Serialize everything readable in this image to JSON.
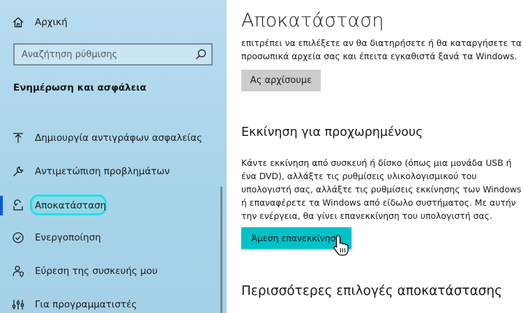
{
  "sidebar": {
    "home_label": "Αρχική",
    "search_placeholder": "Αναζήτηση ρύθμισης",
    "section_heading": "Ενημέρωση και ασφάλεια",
    "items": [
      {
        "label": "Δημιουργία αντιγράφων ασφαλείας",
        "icon": "backup-arrow-icon"
      },
      {
        "label": "Αντιμετώπιση προβλημάτων",
        "icon": "wrench-icon"
      },
      {
        "label": "Αποκατάσταση",
        "icon": "recovery-icon",
        "active": true
      },
      {
        "label": "Ενεργοποίηση",
        "icon": "check-circle-icon"
      },
      {
        "label": "Εύρεση της συσκευής μου",
        "icon": "person-location-icon"
      },
      {
        "label": "Για προγραμματιστές",
        "icon": "developer-tools-icon"
      }
    ]
  },
  "main": {
    "title": "Αποκατάσταση",
    "reset_text": [
      "επιτρέπει να επιλέξετε αν θα διατηρήσετε ή θα καταργήσετε τα",
      "προσωπικά αρχεία σας και έπειτα εγκαθιστά ξανά τα Windows."
    ],
    "reset_button": "Ας αρχίσουμε",
    "advanced_heading": "Εκκίνηση για προχωρημένους",
    "advanced_text": [
      "Κάντε εκκίνηση από συσκευή ή δίσκο (όπως μια μονάδα USB ή",
      "ένα DVD), αλλάξτε τις ρυθμίσεις υλικολογισμικού του",
      "υπολογιστή σας, αλλάξτε τις ρυθμίσεις εκκίνησης των Windows",
      "ή επαναφέρετε τα Windows από είδωλο συστήματος. Με αυτήν",
      "την ενέργεια, θα γίνει επανεκκίνηση του υπολογιστή σας."
    ],
    "restart_button": "Άμεση επανεκκίνηση",
    "more_heading": "Περισσότερες επιλογές αποκατάστασης"
  },
  "colors": {
    "sidebar_bg": "#aad4ea",
    "accent_bar": "#0a5ad6",
    "highlight_outline": "#22e0e6",
    "restart_button_bg": "#00c2c7",
    "secondary_button_bg": "#cccccc"
  }
}
